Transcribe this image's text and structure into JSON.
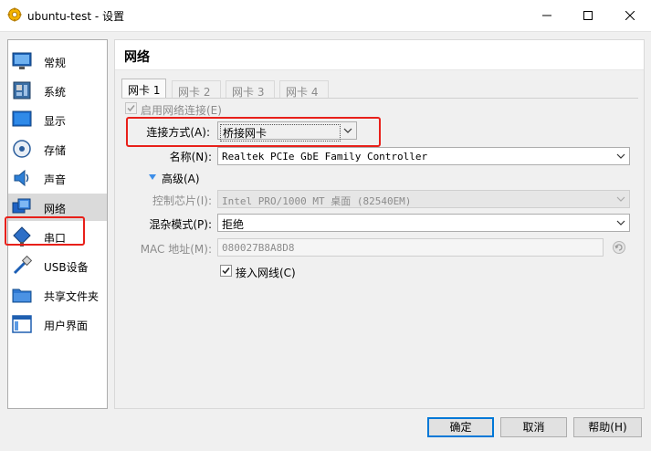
{
  "window": {
    "title": "ubuntu-test - 设置",
    "app_icon": "virtualbox-gear-icon"
  },
  "sidebar": {
    "items": [
      {
        "label": "常规",
        "icon": "monitor-general-icon"
      },
      {
        "label": "系统",
        "icon": "motherboard-icon"
      },
      {
        "label": "显示",
        "icon": "display-icon"
      },
      {
        "label": "存储",
        "icon": "storage-disk-icon"
      },
      {
        "label": "声音",
        "icon": "speaker-icon"
      },
      {
        "label": "网络",
        "icon": "network-icon",
        "selected": true
      },
      {
        "label": "串口",
        "icon": "serial-port-icon"
      },
      {
        "label": "USB设备",
        "icon": "usb-icon"
      },
      {
        "label": "共享文件夹",
        "icon": "shared-folder-icon"
      },
      {
        "label": "用户界面",
        "icon": "user-interface-icon"
      }
    ]
  },
  "panel": {
    "title": "网络",
    "tabs": [
      "网卡 1",
      "网卡 2",
      "网卡 3",
      "网卡 4"
    ],
    "active_tab": 0
  },
  "form": {
    "enable_label": "启用网络连接(E)",
    "enable_checked": true,
    "attached_label": "连接方式(A):",
    "attached_value": "桥接网卡",
    "name_label": "名称(N):",
    "name_value": "Realtek PCIe GbE Family Controller",
    "advanced_label": "高级(A)",
    "adapter_type_label": "控制芯片(I):",
    "adapter_type_value": "Intel PRO/1000 MT 桌面 (82540EM)",
    "promisc_label": "混杂模式(P):",
    "promisc_value": "拒绝",
    "mac_label": "MAC 地址(M):",
    "mac_value": "080027B8A8D8",
    "cable_label": "接入网线(C)",
    "cable_checked": true
  },
  "buttons": {
    "ok": "确定",
    "cancel": "取消",
    "help": "帮助(H)"
  },
  "colors": {
    "highlight_red": "#e8201a",
    "default_button_border": "#0078d7",
    "selected_item": "#dadada"
  }
}
